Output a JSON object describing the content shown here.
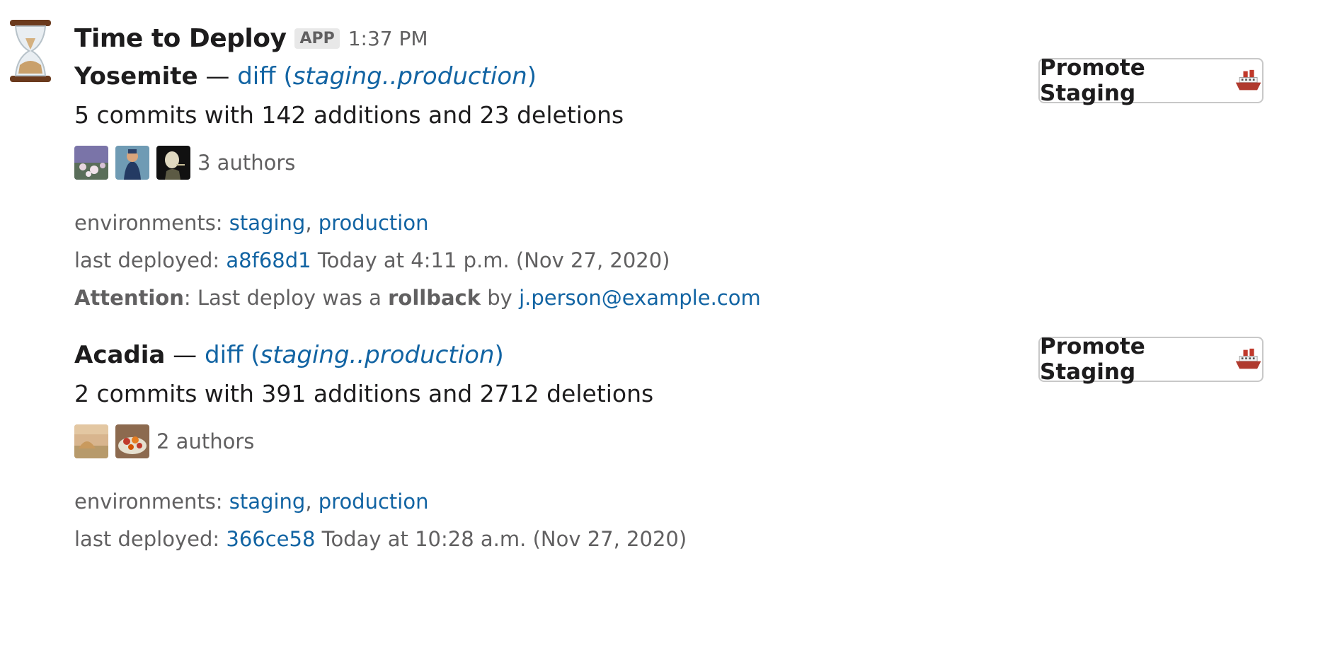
{
  "message": {
    "app_name": "Time to Deploy",
    "app_badge": "APP",
    "time": "1:37 PM",
    "avatar_icon": "hourglass-icon"
  },
  "projects": [
    {
      "name": "Yosemite",
      "separator": "—",
      "diff_label": "diff",
      "diff_range": "staging..production",
      "summary": "5 commits with 142 additions and 23 deletions",
      "authors_label": "3 authors",
      "environments_label": "environments:",
      "environments": [
        "staging",
        "production"
      ],
      "last_deployed_label": "last deployed:",
      "last_deployed_sha": "a8f68d1",
      "last_deployed_time": "Today at 4:11 p.m. (Nov 27, 2020)",
      "attention_label": "Attention",
      "attention_text": ": Last deploy was a",
      "attention_bold": "rollback",
      "attention_by": "by",
      "attention_email": "j.person@example.com",
      "button_label": "Promote Staging",
      "button_icon": "ship-icon"
    },
    {
      "name": "Acadia",
      "separator": "—",
      "diff_label": "diff",
      "diff_range": "staging..production",
      "summary": "2 commits with 391 additions and 2712 deletions",
      "authors_label": "2 authors",
      "environments_label": "environments:",
      "environments": [
        "staging",
        "production"
      ],
      "last_deployed_label": "last deployed:",
      "last_deployed_sha": "366ce58",
      "last_deployed_time": "Today at 10:28 a.m. (Nov 27, 2020)",
      "button_label": "Promote Staging",
      "button_icon": "ship-icon"
    }
  ],
  "colors": {
    "link": "#1264a3",
    "text": "#1d1c1d",
    "muted": "#616061"
  }
}
